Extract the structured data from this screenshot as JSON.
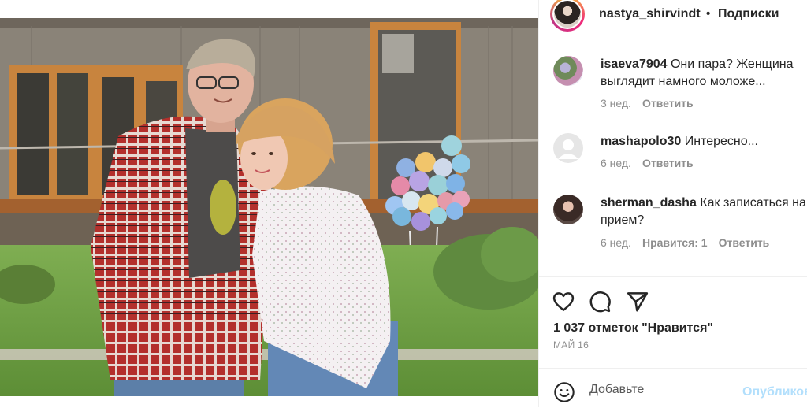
{
  "post": {
    "photo_alt": "Фото"
  },
  "header": {
    "username": "nastya_shirvindt",
    "separator": "•",
    "follow_label": "Подписки"
  },
  "comments": [
    {
      "user": "isaeva7904",
      "text": "Они пара? Женщина выглядит намного моложе...",
      "time": "3 нед.",
      "likes": "",
      "reply": "Ответить"
    },
    {
      "user": "mashapolo30",
      "text": "Интересно...",
      "time": "6 нед.",
      "likes": "",
      "reply": "Ответить"
    },
    {
      "user": "sherman_dasha",
      "text": "Как записаться на прием?",
      "time": "6 нед.",
      "likes": "Нравится: 1",
      "reply": "Ответить"
    }
  ],
  "actions": {
    "like_icon": "heart-icon",
    "comment_icon": "comment-bubble-icon",
    "share_icon": "paper-plane-icon",
    "likes_count": "1 037 отметок \"Нравится\"",
    "date": "МАЙ 16"
  },
  "add_comment": {
    "placeholder": "Добавьте",
    "publish_label": "Опубликов",
    "emoji_icon": "smiley-icon"
  },
  "colors": {
    "link_disabled": "#b2dffc",
    "meta_gray": "#8e8e8e",
    "text": "#262626"
  }
}
